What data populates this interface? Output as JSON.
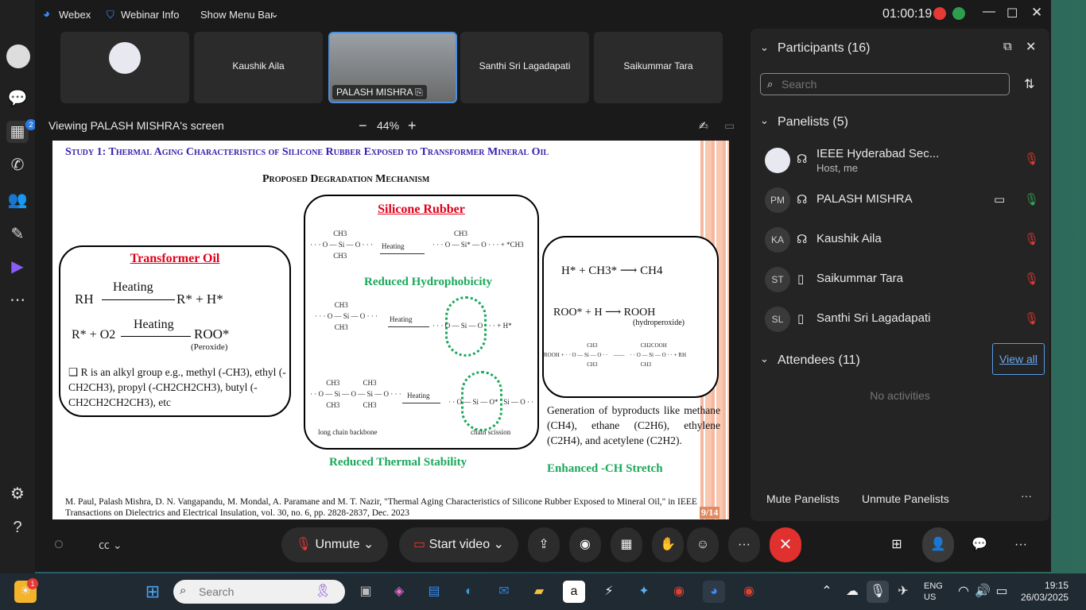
{
  "app": {
    "name": "Webex",
    "webinar_info": "Webinar Info",
    "show_menu_bar": "Show Menu Bar",
    "timer": "01:00:19"
  },
  "sidebar": {
    "badge_count": "2"
  },
  "videos": [
    {
      "name": ""
    },
    {
      "name": "Kaushik Aila"
    },
    {
      "name": "PALASH MISHRA"
    },
    {
      "name": "Santhi Sri Lagadapati"
    },
    {
      "name": "Saikummar Tara"
    }
  ],
  "share": {
    "viewing_label": "Viewing PALASH MISHRA's screen",
    "zoom": "44%"
  },
  "slide": {
    "study_title": "Study 1: Thermal Aging Characteristics of Silicone Rubber Exposed to Transformer Mineral Oil",
    "mechanism_title": "Proposed Degradation Mechanism",
    "transformer_oil_title": "Transformer Oil",
    "eq1_left": "RH",
    "eq1_arrow": "Heating",
    "eq1_right": "R* + H*",
    "eq2_left": "R* + O2",
    "eq2_arrow": "Heating",
    "eq2_right": "ROO*",
    "eq2_note": "(Peroxide)",
    "alkyl_note": "❑ R is an alkyl group e.g., methyl (-CH3), ethyl (-CH2CH3), propyl (-CH2CH2CH3), butyl (-CH2CH2CH2CH3), etc",
    "silicone_title": "Silicone Rubber",
    "heating": "Heating",
    "reduced_hydrophobicity": "Reduced Hydrophobicity",
    "long_chain": "long chain backbone",
    "chain_scission": "chain scission",
    "reduced_thermal": "Reduced Thermal Stability",
    "right_eq1": "H* + CH3* ⟶ CH4",
    "right_eq2": "ROO* + H ⟶ ROOH",
    "right_eq2_note": "(hydroperoxide)",
    "byproducts": "Generation of byproducts like methane (CH4), ethane (C2H6), ethylene (C2H4), and acetylene (C2H2).",
    "enhanced": "Enhanced -CH Stretch",
    "citation": "M. Paul, Palash Mishra, D. N. Vangapandu, M. Mondal, A. Paramane and M. T. Nazir, \"Thermal Aging Characteristics of Silicone Rubber Exposed to Mineral Oil,\" in IEEE Transactions on Dielectrics and Electrical Insulation, vol. 30, no. 6, pp. 2828-2837, Dec. 2023",
    "page_number": "9/14"
  },
  "participants": {
    "title": "Participants (16)",
    "search_placeholder": "Search",
    "panelists_header": "Panelists (5)",
    "panelists": [
      {
        "initials": "",
        "name": "IEEE Hyderabad Sec...",
        "role": "Host, me"
      },
      {
        "initials": "PM",
        "name": "PALASH MISHRA",
        "role": ""
      },
      {
        "initials": "KA",
        "name": "Kaushik Aila",
        "role": ""
      },
      {
        "initials": "ST",
        "name": "Saikummar Tara",
        "role": ""
      },
      {
        "initials": "SL",
        "name": "Santhi Sri Lagadapati",
        "role": ""
      }
    ],
    "attendees_header": "Attendees (11)",
    "view_all": "View all",
    "no_activities": "No activities",
    "mute_panelists": "Mute Panelists",
    "unmute_panelists": "Unmute Panelists"
  },
  "controls": {
    "unmute": "Unmute",
    "start_video": "Start video"
  },
  "taskbar": {
    "search_placeholder": "Search",
    "lang1": "ENG",
    "lang2": "US",
    "time": "19:15",
    "date": "26/03/2025",
    "mail_badge": "1"
  }
}
